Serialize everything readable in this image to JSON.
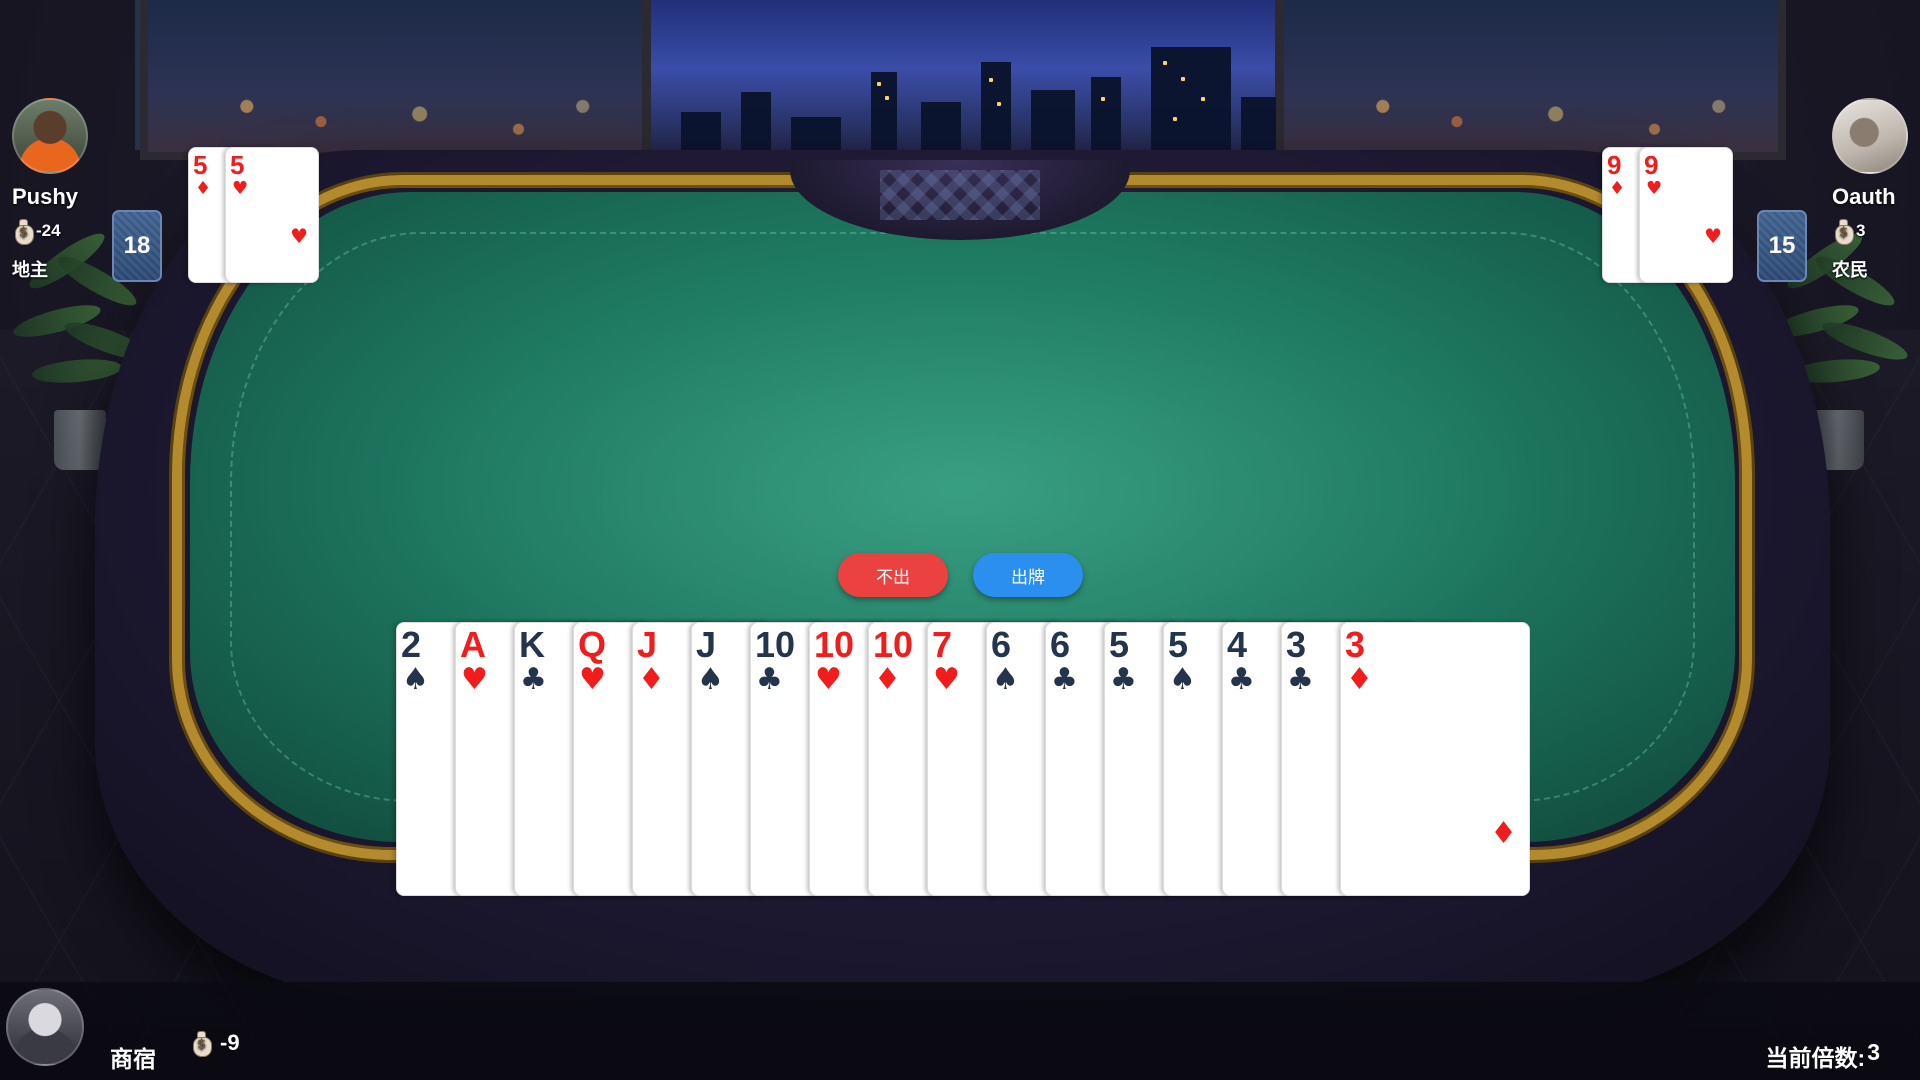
{
  "players": {
    "left": {
      "name": "Pushy",
      "money": "-24",
      "role": "地主",
      "cards_left": "18"
    },
    "right": {
      "name": "Oauth",
      "money": "3",
      "role": "农民",
      "cards_left": "15"
    },
    "self": {
      "name": "商宿",
      "money": "-9"
    }
  },
  "played": {
    "left": [
      {
        "rank": "5",
        "suit": "♦",
        "color": "red"
      },
      {
        "rank": "5",
        "suit": "♥",
        "color": "red"
      }
    ],
    "right": [
      {
        "rank": "9",
        "suit": "♦",
        "color": "red"
      },
      {
        "rank": "9",
        "suit": "♥",
        "color": "red"
      }
    ]
  },
  "hand": [
    {
      "rank": "2",
      "suit": "♠",
      "color": "black"
    },
    {
      "rank": "A",
      "suit": "♥",
      "color": "red"
    },
    {
      "rank": "K",
      "suit": "♣",
      "color": "black"
    },
    {
      "rank": "Q",
      "suit": "♥",
      "color": "red"
    },
    {
      "rank": "J",
      "suit": "♦",
      "color": "red"
    },
    {
      "rank": "J",
      "suit": "♠",
      "color": "black"
    },
    {
      "rank": "10",
      "suit": "♣",
      "color": "black"
    },
    {
      "rank": "10",
      "suit": "♥",
      "color": "red"
    },
    {
      "rank": "10",
      "suit": "♦",
      "color": "red"
    },
    {
      "rank": "7",
      "suit": "♥",
      "color": "red"
    },
    {
      "rank": "6",
      "suit": "♠",
      "color": "black"
    },
    {
      "rank": "6",
      "suit": "♣",
      "color": "black"
    },
    {
      "rank": "5",
      "suit": "♣",
      "color": "black"
    },
    {
      "rank": "5",
      "suit": "♠",
      "color": "black"
    },
    {
      "rank": "4",
      "suit": "♣",
      "color": "black"
    },
    {
      "rank": "3",
      "suit": "♣",
      "color": "black"
    },
    {
      "rank": "3",
      "suit": "♦",
      "color": "red"
    }
  ],
  "actions": {
    "pass_label": "不出",
    "play_label": "出牌"
  },
  "status": {
    "multiplier_label": "当前倍数:",
    "multiplier_value": "3"
  },
  "icons": {
    "money": "money-bag-icon",
    "card_back": "card-back-icon"
  },
  "colors": {
    "pass_button": "#ec4141",
    "play_button": "#2b8ff0",
    "felt": "#1f7b62",
    "red_suit": "#f11d1d",
    "black_suit": "#24344d"
  }
}
